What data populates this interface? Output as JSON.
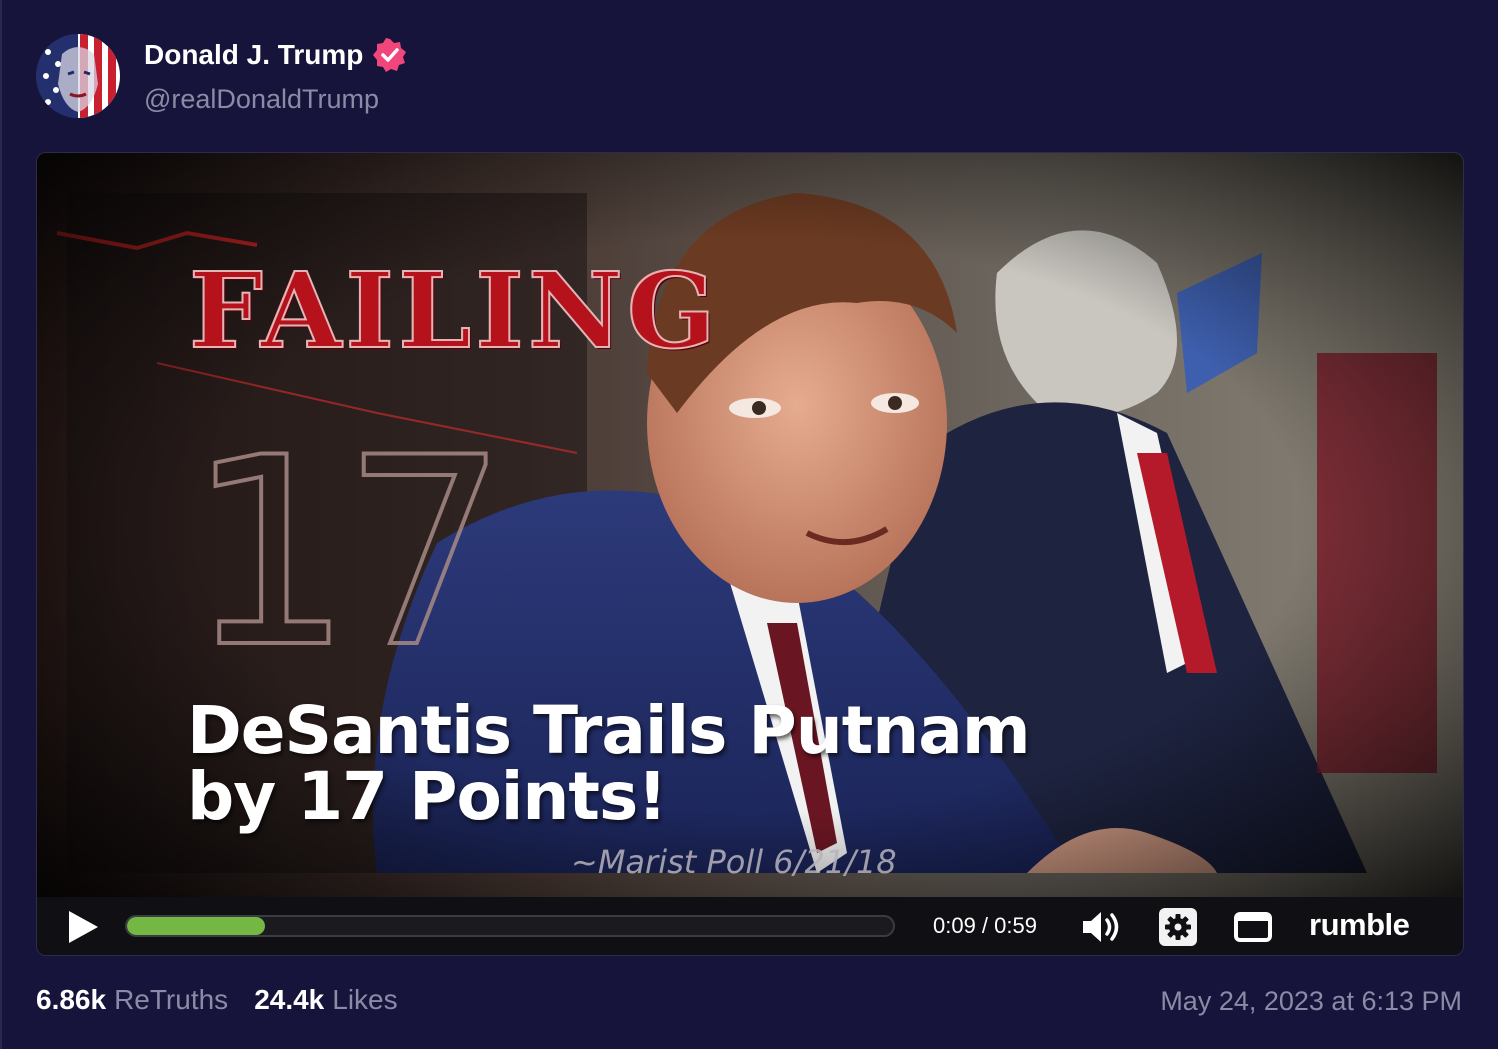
{
  "author": {
    "display_name": "Donald J. Trump",
    "handle": "@realDonaldTrump",
    "verified": true,
    "avatar_icon": "avatar-flag-face"
  },
  "video": {
    "overlay": {
      "failing": "FAILING",
      "number": "17",
      "headline_line1": "DeSantis Trails Putnam",
      "headline_line2": "by 17 Points!",
      "source": "~Marist Poll 6/21/18"
    },
    "controls": {
      "time": "0:09 / 0:59",
      "progress": 0.18,
      "brand": "rumble",
      "play_icon": "play-icon",
      "volume_icon": "volume-icon",
      "settings_icon": "gear-icon",
      "fullscreen_icon": "fullscreen-icon"
    }
  },
  "stats": {
    "retruths_count": "6.86k",
    "retruths_label": "ReTruths",
    "likes_count": "24.4k",
    "likes_label": "Likes"
  },
  "timestamp": "May 24, 2023 at 6:13 PM",
  "colors": {
    "background": "#16143a",
    "badge": "#f0467b",
    "progress": "#74b843",
    "muted_text": "#8c8aa6"
  }
}
